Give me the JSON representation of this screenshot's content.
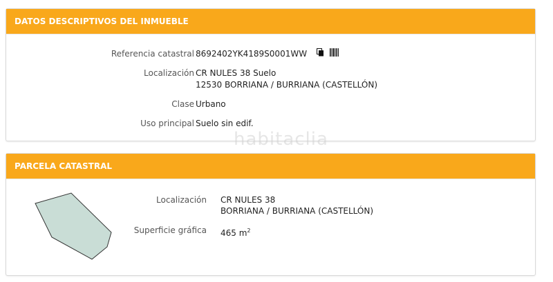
{
  "panel1": {
    "title": "DATOS DESCRIPTIVOS DEL INMUEBLE",
    "ref_label": "Referencia catastral",
    "ref_value": "8692402YK4189S0001WW",
    "loc_label": "Localización",
    "loc_line1": "CR NULES 38 Suelo",
    "loc_line2": "12530 BORRIANA / BURRIANA (CASTELLÓN)",
    "clase_label": "Clase",
    "clase_value": "Urbano",
    "uso_label": "Uso principal",
    "uso_value": "Suelo sin edif."
  },
  "panel2": {
    "title": "PARCELA CATASTRAL",
    "loc_label": "Localización",
    "loc_line1": "CR NULES 38",
    "loc_line2": "BORRIANA / BURRIANA (CASTELLÓN)",
    "sup_label": "Superficie gráfica",
    "sup_value": "465 m",
    "sup_exp": "2"
  },
  "watermark": "habitaclia",
  "colors": {
    "header": "#f9a81b",
    "parcel_fill": "#c9ddd6"
  },
  "icons": [
    "copy-icon",
    "barcode-icon"
  ]
}
